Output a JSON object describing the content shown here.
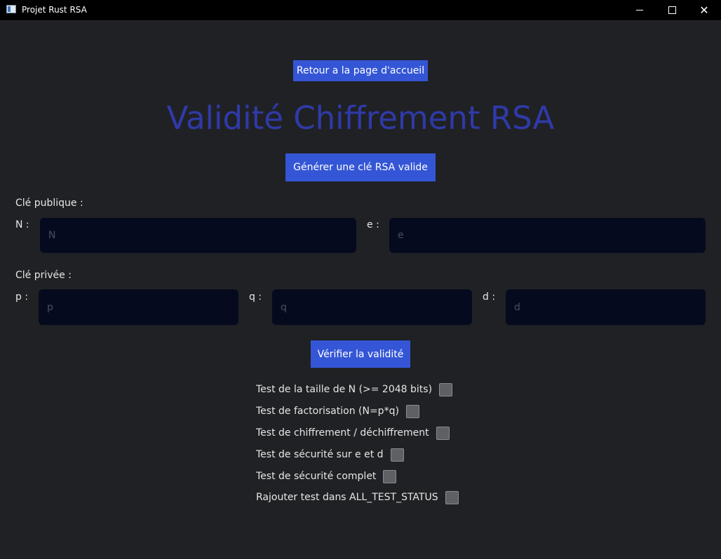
{
  "window": {
    "title": "Projet Rust RSA"
  },
  "home_button": "Retour a la page d'accueil",
  "page_title": "Validité Chiffrement RSA",
  "generate_button": "Générer une clé RSA valide",
  "public_key": {
    "heading": "Clé publique :",
    "n_label": "N :",
    "n_placeholder": "N",
    "e_label": "e :",
    "e_placeholder": "e"
  },
  "private_key": {
    "heading": "Clé privée :",
    "p_label": "p :",
    "p_placeholder": "p",
    "q_label": "q :",
    "q_placeholder": "q",
    "d_label": "d :",
    "d_placeholder": "d"
  },
  "verify_button": "Vérifier la validité",
  "tests": [
    {
      "label": "Test de la taille de N (>= 2048 bits)",
      "checked": false
    },
    {
      "label": "Test de factorisation (N=p*q)",
      "checked": false
    },
    {
      "label": "Test de chiffrement / déchiffrement",
      "checked": false
    },
    {
      "label": "Test de sécurité sur e et d",
      "checked": false
    },
    {
      "label": "Test de sécurité complet",
      "checked": false
    },
    {
      "label": "Rajouter test dans ALL_TEST_STATUS",
      "checked": false
    }
  ],
  "colors": {
    "background": "#202124",
    "accent_button": "#3456d6",
    "title_text": "#2f3aa8",
    "input_background": "#050a1e"
  }
}
